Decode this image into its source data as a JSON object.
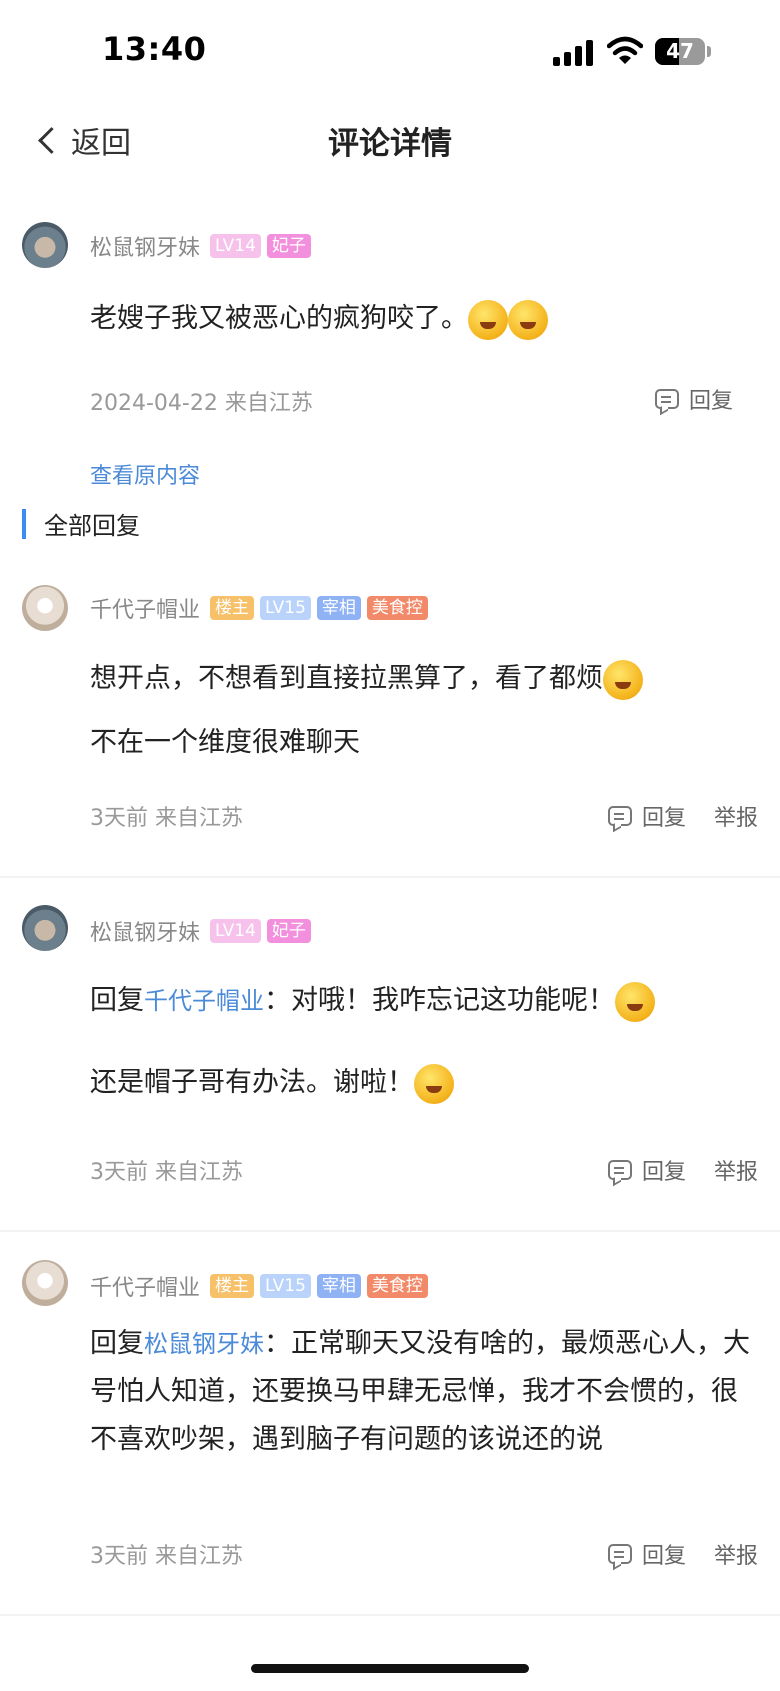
{
  "status": {
    "time": "13:40",
    "battery": "47",
    "battery_level": 0.47
  },
  "nav": {
    "back_label": "返回",
    "title": "评论详情"
  },
  "main_comment": {
    "username": "松鼠钢牙妹",
    "badges": [
      "LV14",
      "妃子"
    ],
    "text": "老嫂子我又被恶心的疯狗咬了。",
    "date_location": "2024-04-22 来自江苏",
    "reply_label": "回复",
    "view_original": "查看原内容"
  },
  "section": {
    "title": "全部回复"
  },
  "replies": [
    {
      "username": "千代子帽业",
      "badges": [
        "楼主",
        "LV15",
        "宰相",
        "美食控"
      ],
      "lines": [
        "想开点，不想看到直接拉黑算了，看了都烦",
        "不在一个维度很难聊天"
      ],
      "meta": "3天前 来自江苏",
      "reply_label": "回复",
      "report_label": "举报"
    },
    {
      "username": "松鼠钢牙妹",
      "badges": [
        "LV14",
        "妃子"
      ],
      "reply_prefix": "回复",
      "reply_to": "千代子帽业",
      "colon": "：",
      "line1": "对哦！我咋忘记这功能呢！",
      "line2": "还是帽子哥有办法。谢啦！",
      "meta": "3天前 来自江苏",
      "reply_label": "回复",
      "report_label": "举报"
    },
    {
      "username": "千代子帽业",
      "badges": [
        "楼主",
        "LV15",
        "宰相",
        "美食控"
      ],
      "reply_prefix": "回复",
      "reply_to": "松鼠钢牙妹",
      "colon": "：",
      "body": "正常聊天又没有啥的，最烦恶心人，大号怕人知道，还要换马甲肆无忌惮，我才不会惯的，很不喜欢吵架，遇到脑子有问题的该说还的说",
      "meta": "3天前 来自江苏",
      "reply_label": "回复",
      "report_label": "举报"
    }
  ]
}
